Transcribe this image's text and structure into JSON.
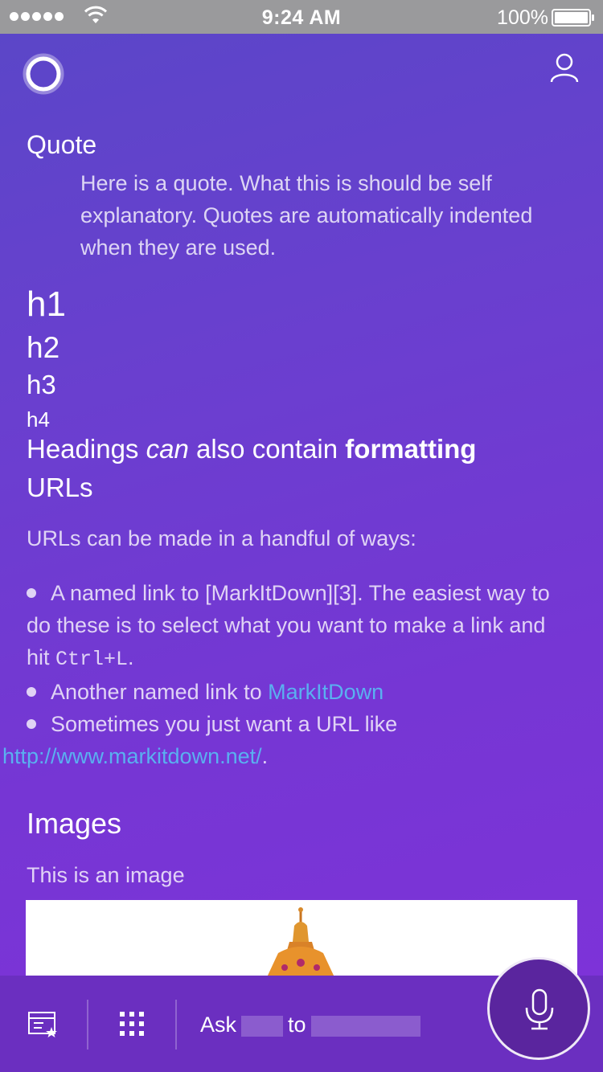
{
  "status": {
    "time": "9:24 AM",
    "battery": "100%"
  },
  "content": {
    "quote_title": "Quote",
    "quote_text": "Here is a quote. What this is should be self explanatory. Quotes are automatically indented when they are used.",
    "h1": "h1",
    "h2": "h2",
    "h3": "h3",
    "h4": "h4",
    "heading_formatting": {
      "part1": "Headings ",
      "italic": "can",
      "part2": " also contain ",
      "bold": "formatting"
    },
    "urls_heading": "URLs",
    "urls_intro": "URLs can be made in a handful of ways:",
    "list": {
      "item1_text": "A named link to [MarkItDown][3]. The easiest way to do these is to select what you want to make a link and hit ",
      "item1_code": "Ctrl+L",
      "item1_end": ".",
      "item2_text": "Another named link to ",
      "item2_link": "MarkItDown",
      "item3_text": "Sometimes you just want a URL like",
      "item3_link": "http://www.markitdown.net/",
      "item3_end": "."
    },
    "images_heading": "Images",
    "image_caption": "This is an image"
  },
  "bottom": {
    "ask_label": "Ask",
    "to_label": "to"
  },
  "colors": {
    "link": "#5ab0f0",
    "accent": "#7a3fd6",
    "bottom_bar": "#6b2fc0"
  },
  "icons": [
    "cortana-icon",
    "profile-icon",
    "notebook-icon",
    "apps-grid-icon",
    "microphone-icon"
  ]
}
